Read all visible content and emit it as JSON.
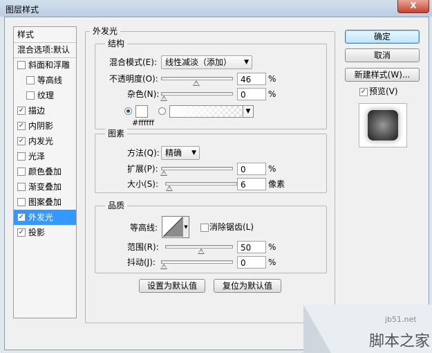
{
  "window": {
    "title": "图层样式",
    "close_label": "X"
  },
  "sidebar": {
    "header": "样式",
    "items": [
      {
        "label": "混合选项:默认",
        "checkbox": false,
        "checked": false,
        "indent": 0
      },
      {
        "label": "斜面和浮雕",
        "checkbox": true,
        "checked": false,
        "indent": 0
      },
      {
        "label": "等高线",
        "checkbox": true,
        "checked": false,
        "indent": 1
      },
      {
        "label": "纹理",
        "checkbox": true,
        "checked": false,
        "indent": 1
      },
      {
        "label": "描边",
        "checkbox": true,
        "checked": true,
        "indent": 0
      },
      {
        "label": "内阴影",
        "checkbox": true,
        "checked": true,
        "indent": 0
      },
      {
        "label": "内发光",
        "checkbox": true,
        "checked": true,
        "indent": 0
      },
      {
        "label": "光泽",
        "checkbox": true,
        "checked": false,
        "indent": 0
      },
      {
        "label": "颜色叠加",
        "checkbox": true,
        "checked": false,
        "indent": 0
      },
      {
        "label": "渐变叠加",
        "checkbox": true,
        "checked": false,
        "indent": 0
      },
      {
        "label": "图案叠加",
        "checkbox": true,
        "checked": false,
        "indent": 0
      },
      {
        "label": "外发光",
        "checkbox": true,
        "checked": true,
        "indent": 0,
        "selected": true
      },
      {
        "label": "投影",
        "checkbox": true,
        "checked": true,
        "indent": 0
      }
    ]
  },
  "panel": {
    "title": "外发光"
  },
  "structure": {
    "title": "结构",
    "blend_mode_label": "混合模式(E):",
    "blend_mode_value": "线性减淡（添加）",
    "opacity_label": "不透明度(O):",
    "opacity_value": "46",
    "opacity_level": 0.46,
    "noise_label": "杂色(N):",
    "noise_value": "0",
    "noise_level": 0,
    "percent": "%",
    "color_hex": "#ffffff"
  },
  "elements": {
    "title": "图素",
    "method_label": "方法(Q):",
    "method_value": "精确",
    "spread_label": "扩展(P):",
    "spread_value": "0",
    "spread_level": 0,
    "size_label": "大小(S):",
    "size_value": "6",
    "size_level": 0.024,
    "size_unit": "像素",
    "percent": "%"
  },
  "quality": {
    "title": "品质",
    "contour_label": "等高线:",
    "antialias_label": "消除锯齿(L)",
    "range_label": "范围(R):",
    "range_value": "50",
    "range_level": 0.5,
    "jitter_label": "抖动(J):",
    "jitter_value": "0",
    "jitter_level": 0,
    "percent": "%"
  },
  "bottom_buttons": {
    "make_default": "设置为默认值",
    "reset_default": "复位为默认值"
  },
  "actions": {
    "ok": "确定",
    "cancel": "取消",
    "new_style": "新建样式(W)...",
    "preview_label": "预览(V)",
    "preview_checked": true
  },
  "watermark": {
    "site": "jb51.net",
    "brand": "脚本之家"
  },
  "colors": {
    "selection": "#3399ff",
    "dialog_bg": "#f0f0f0"
  }
}
